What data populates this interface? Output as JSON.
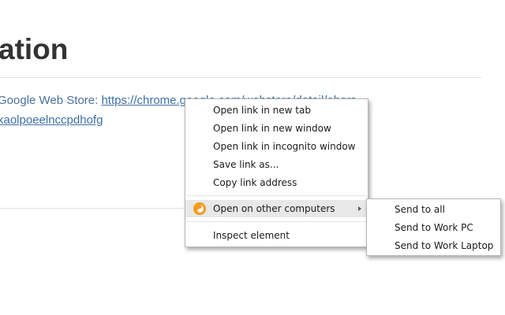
{
  "page": {
    "heading": "ation",
    "store_prefix": "Google Web Store: ",
    "store_link": "https://chrome.google.com/webstore/detail/ehgrs",
    "link_line2": "kaolpoeelnccpdhofg"
  },
  "context_menu": {
    "items": [
      {
        "label": "Open link in new tab"
      },
      {
        "label": "Open link in new window"
      },
      {
        "label": "Open link in incognito window"
      },
      {
        "label": "Save link as..."
      },
      {
        "label": "Copy link address"
      },
      {
        "label": "Open on other computers",
        "icon": "other-computers-icon",
        "has_submenu": true,
        "highlighted": true
      },
      {
        "label": "Inspect element"
      }
    ]
  },
  "submenu": {
    "items": [
      {
        "label": "Send to all"
      },
      {
        "label": "Send to Work PC"
      },
      {
        "label": "Send to Work Laptop"
      }
    ]
  },
  "colors": {
    "link": "#3e6fa8",
    "heading": "#333333",
    "menu_highlight": "#e8e8e8",
    "icon_orange": "#f39c1f"
  }
}
